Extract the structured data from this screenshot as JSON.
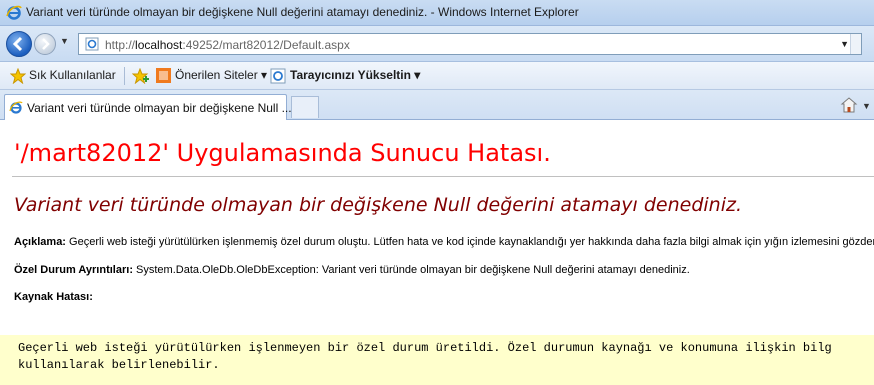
{
  "window": {
    "title": "Variant veri türünde olmayan bir değişkene Null değerini atamayı denediniz. - Windows Internet Explorer"
  },
  "address": {
    "url_prefix": "http://",
    "url_host": "localhost",
    "url_rest": ":49252/mart82012/Default.aspx"
  },
  "favorites": {
    "label": "Sık Kullanılanlar",
    "suggested_sites": "Önerilen Siteler ▾",
    "upgrade_browser": "Tarayıcınızı Yükseltin ▾"
  },
  "tabs": [
    {
      "label": "Variant veri türünde olmayan bir değişkene Null ..."
    }
  ],
  "page": {
    "heading": "'/mart82012' Uygulamasında Sunucu Hatası.",
    "subheading": "Variant veri türünde olmayan bir değişkene Null değerini atamayı denediniz.",
    "description_label": "Açıklama:",
    "description_text": " Geçerli web isteği yürütülürken işlenmemiş özel durum oluştu. Lütfen hata ve kod içinde kaynaklandığı yer hakkında daha fazla bilgi almak için yığın izlemesini gözden geçirin.",
    "exception_label": "Özel Durum Ayrıntıları:",
    "exception_text": " System.Data.OleDb.OleDbException: Variant veri türünde olmayan bir değişkene Null değerini atamayı denediniz.",
    "source_error_label": "Kaynak Hatası:",
    "code_line1": "Geçerli web isteği yürütülürken işlenmeyen bir özel durum üretildi. Özel durumun kaynağı ve konumuna ilişkin bilg",
    "code_line2": "kullanılarak belirlenebilir."
  },
  "colors": {
    "heading": "#ff0000",
    "subheading": "#800000",
    "code_background": "#ffffcc"
  }
}
